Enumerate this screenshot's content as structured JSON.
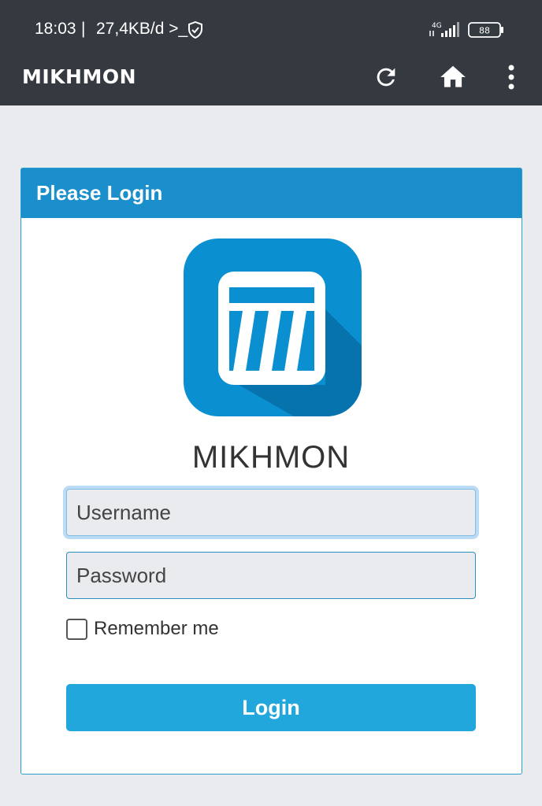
{
  "status_bar": {
    "time": "18:03",
    "separator": "|",
    "network_speed": "27,4KB/d >_",
    "network_type": "4G",
    "battery_level": "88"
  },
  "app_bar": {
    "title": "MIKHMON",
    "icons": [
      "refresh-icon",
      "home-icon",
      "more-vert-icon"
    ]
  },
  "login_card": {
    "header": "Please Login",
    "brand_name": "MIKHMON",
    "username_placeholder": "Username",
    "password_placeholder": "Password",
    "remember_label": "Remember me",
    "login_label": "Login"
  },
  "colors": {
    "topbar": "#343a40",
    "card_header": "#1a8fcb",
    "login_button": "#22a7dc",
    "logo_blue": "#0a8fd1"
  }
}
